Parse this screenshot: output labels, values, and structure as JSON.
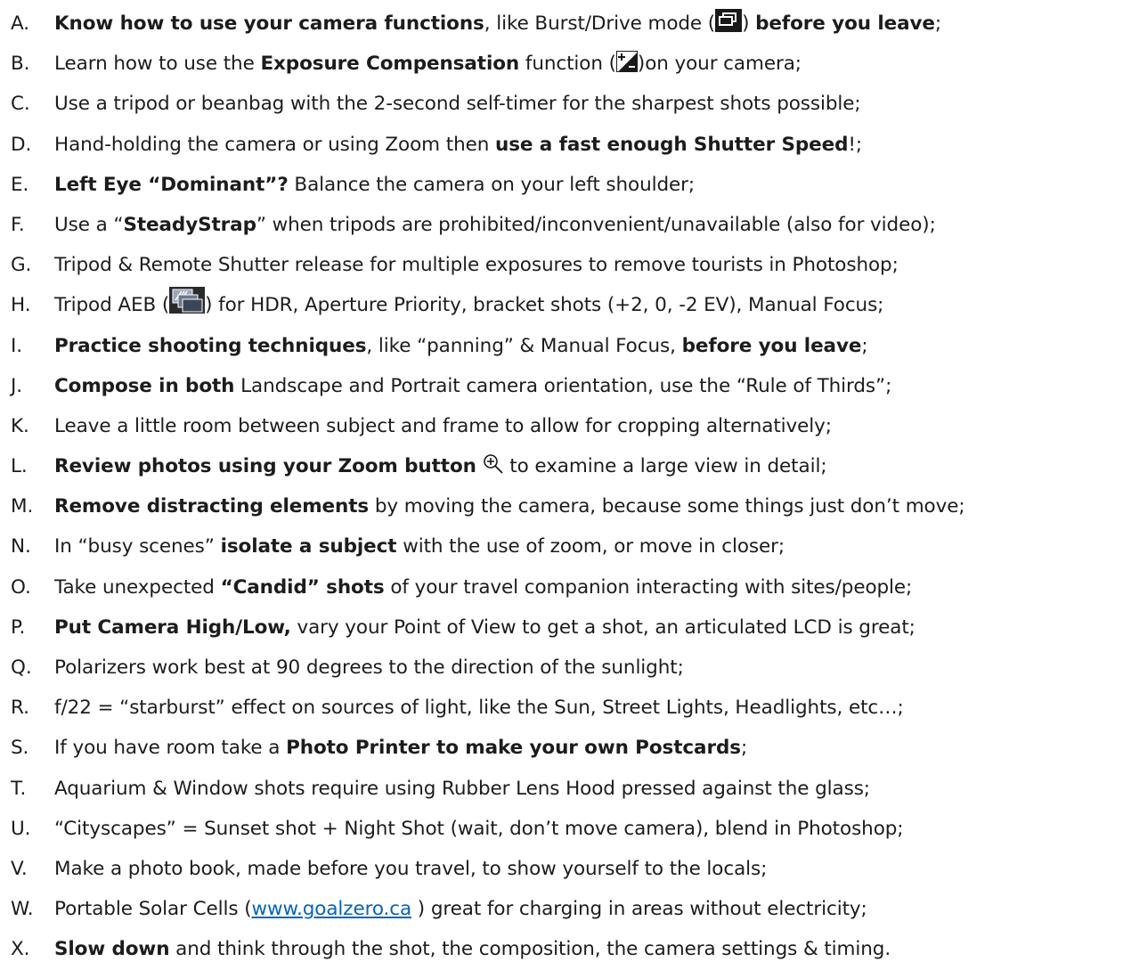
{
  "tips": [
    {
      "letter": "A.",
      "segments": [
        {
          "t": "b",
          "v": "Know how to use your camera functions"
        },
        {
          "t": "n",
          "v": ", like Burst/Drive mode ("
        },
        {
          "t": "icon",
          "v": "burst-drive-mode-icon"
        },
        {
          "t": "n",
          "v": ") "
        },
        {
          "t": "b",
          "v": "before you leave"
        },
        {
          "t": "n",
          "v": ";"
        }
      ]
    },
    {
      "letter": "B.",
      "segments": [
        {
          "t": "n",
          "v": "Learn how to use the "
        },
        {
          "t": "b",
          "v": "Exposure Compensation"
        },
        {
          "t": "n",
          "v": " function ("
        },
        {
          "t": "icon",
          "v": "exposure-compensation-icon"
        },
        {
          "t": "n",
          "v": ")on your camera;"
        }
      ]
    },
    {
      "letter": "C.",
      "segments": [
        {
          "t": "n",
          "v": "Use a tripod or beanbag with the 2-second self-timer for the sharpest shots possible;"
        }
      ]
    },
    {
      "letter": "D.",
      "segments": [
        {
          "t": "n",
          "v": "Hand-holding the camera or using Zoom then "
        },
        {
          "t": "b",
          "v": "use a fast enough Shutter Speed"
        },
        {
          "t": "n",
          "v": "!;"
        }
      ]
    },
    {
      "letter": "E.",
      "segments": [
        {
          "t": "b",
          "v": "Left Eye “Dominant”?"
        },
        {
          "t": "n",
          "v": " Balance the camera on your left shoulder;"
        }
      ]
    },
    {
      "letter": "F.",
      "segments": [
        {
          "t": "n",
          "v": "Use a “"
        },
        {
          "t": "b",
          "v": "SteadyStrap"
        },
        {
          "t": "n",
          "v": "” when tripods are prohibited/inconvenient/unavailable (also for video);"
        }
      ]
    },
    {
      "letter": "G.",
      "segments": [
        {
          "t": "n",
          "v": "Tripod & Remote Shutter release for multiple exposures to remove tourists in Photoshop;"
        }
      ]
    },
    {
      "letter": "H.",
      "segments": [
        {
          "t": "n",
          "v": "Tripod AEB ("
        },
        {
          "t": "icon",
          "v": "aeb-bracket-icon"
        },
        {
          "t": "n",
          "v": ") for HDR, Aperture Priority, bracket shots (+2, 0, -2 EV), Manual Focus;"
        }
      ]
    },
    {
      "letter": "I.",
      "segments": [
        {
          "t": "b",
          "v": "Practice shooting techniques"
        },
        {
          "t": "n",
          "v": ", like “panning” & Manual Focus, "
        },
        {
          "t": "b",
          "v": "before you leave"
        },
        {
          "t": "n",
          "v": ";"
        }
      ]
    },
    {
      "letter": "J.",
      "segments": [
        {
          "t": "b",
          "v": "Compose in both"
        },
        {
          "t": "n",
          "v": " Landscape and Portrait camera orientation, use the “Rule of Thirds”;"
        }
      ]
    },
    {
      "letter": "K.",
      "segments": [
        {
          "t": "n",
          "v": "Leave a little room between subject and frame to allow for cropping alternatively;"
        }
      ]
    },
    {
      "letter": "L.",
      "segments": [
        {
          "t": "b",
          "v": "Review photos using your Zoom button"
        },
        {
          "t": "n",
          "v": " "
        },
        {
          "t": "icon",
          "v": "zoom-in-icon"
        },
        {
          "t": "n",
          "v": " to examine a large view in detail;"
        }
      ]
    },
    {
      "letter": "M.",
      "segments": [
        {
          "t": "b",
          "v": "Remove distracting elements"
        },
        {
          "t": "n",
          "v": " by moving the camera, because some things just don’t move;"
        }
      ]
    },
    {
      "letter": "N.",
      "segments": [
        {
          "t": "n",
          "v": "In “busy scenes” "
        },
        {
          "t": "b",
          "v": "isolate a subject"
        },
        {
          "t": "n",
          "v": " with the use of zoom, or move in closer;"
        }
      ]
    },
    {
      "letter": "O.",
      "segments": [
        {
          "t": "n",
          "v": "Take unexpected "
        },
        {
          "t": "b",
          "v": "“Candid” shots"
        },
        {
          "t": "n",
          "v": " of your travel companion interacting with sites/people;"
        }
      ]
    },
    {
      "letter": "P.",
      "segments": [
        {
          "t": "b",
          "v": "Put Camera High/Low,"
        },
        {
          "t": "n",
          "v": " vary your Point of View to get a shot, an articulated LCD is great;"
        }
      ]
    },
    {
      "letter": "Q.",
      "segments": [
        {
          "t": "n",
          "v": "Polarizers work best at 90 degrees to the direction of the sunlight;"
        }
      ]
    },
    {
      "letter": "R.",
      "segments": [
        {
          "t": "n",
          "v": "f/22 = “starburst” effect on sources of light, like the Sun, Street Lights, Headlights, etc…;"
        }
      ]
    },
    {
      "letter": "S.",
      "segments": [
        {
          "t": "n",
          "v": "If you have room take a "
        },
        {
          "t": "b",
          "v": "Photo Printer to make your own Postcards"
        },
        {
          "t": "n",
          "v": ";"
        }
      ]
    },
    {
      "letter": "T.",
      "segments": [
        {
          "t": "n",
          "v": "Aquarium & Window shots require using Rubber Lens Hood pressed against the glass;"
        }
      ]
    },
    {
      "letter": "U.",
      "segments": [
        {
          "t": "n",
          "v": " “Cityscapes” = Sunset shot + Night Shot (wait, don’t move camera), blend in Photoshop;"
        }
      ]
    },
    {
      "letter": "V.",
      "segments": [
        {
          "t": "n",
          "v": "Make a photo book, made before you travel, to show yourself to the locals;"
        }
      ]
    },
    {
      "letter": "W.",
      "segments": [
        {
          "t": "n",
          "v": "Portable Solar Cells ("
        },
        {
          "t": "link",
          "v": "www.goalzero.ca"
        },
        {
          "t": "n",
          "v": " ) great for charging in areas without electricity;"
        }
      ]
    },
    {
      "letter": "X.",
      "segments": [
        {
          "t": "b",
          "v": "Slow down"
        },
        {
          "t": "n",
          "v": " and think through the shot, the composition, the camera settings & timing."
        }
      ]
    }
  ],
  "colors": {
    "text": "#1c1c1c",
    "link": "#0563c1",
    "icon_dark": "#1a1a1a"
  }
}
